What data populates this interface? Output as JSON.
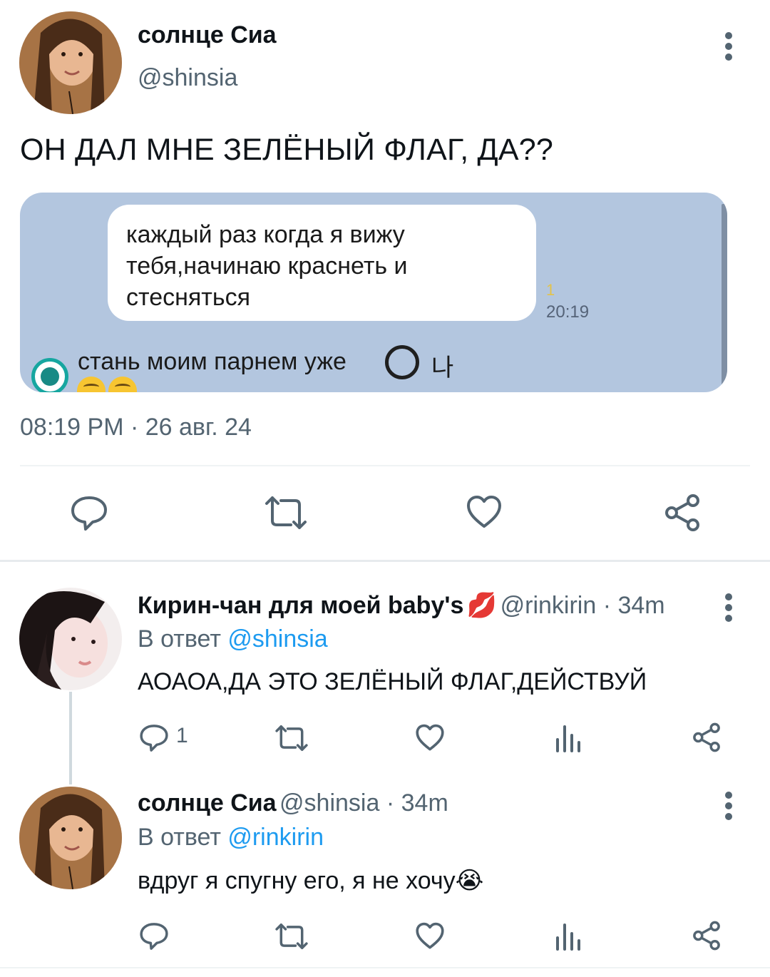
{
  "main_tweet": {
    "author_name": "солнце Сиа",
    "author_handle": "@shinsia",
    "text": "ОН ДАЛ МНЕ ЗЕЛЁНЫЙ ФЛАГ, ДА??",
    "media": {
      "bubble_text": "каждый раз когда я вижу тебя,начинаю краснеть и стесняться",
      "unread_count": "1",
      "time": "20:19",
      "selected_option": "стань моим парнем уже",
      "other_option": "나"
    },
    "timestamp": "08:19 PM · 26 авг. 24",
    "actions": [
      "reply-icon",
      "retweet-icon",
      "like-icon",
      "share-icon"
    ]
  },
  "replies": [
    {
      "author_name": "Кирин-чан для моей baby's",
      "name_emoji": "💋",
      "author_handle": "@rinkirin",
      "meta_sep": " · ",
      "time": "34m",
      "reply_prefix": "В ответ ",
      "reply_to": "@shinsia",
      "text": "АОАОА,ДА ЭТО ЗЕЛЁНЫЙ ФЛАГ,ДЕЙСТВУЙ",
      "reply_count": "1"
    },
    {
      "author_name": "солнце Сиа",
      "author_handle": "@shinsia",
      "meta_sep": " · ",
      "time": "34m",
      "reply_prefix": "В ответ ",
      "reply_to": "@rinkirin",
      "text": "вдруг я спугну его, я не хочу",
      "text_emoji": "😭"
    }
  ],
  "colors": {
    "accent": "#1d9bf0",
    "secondary_text": "#536471",
    "media_bg": "#b3c6df"
  }
}
